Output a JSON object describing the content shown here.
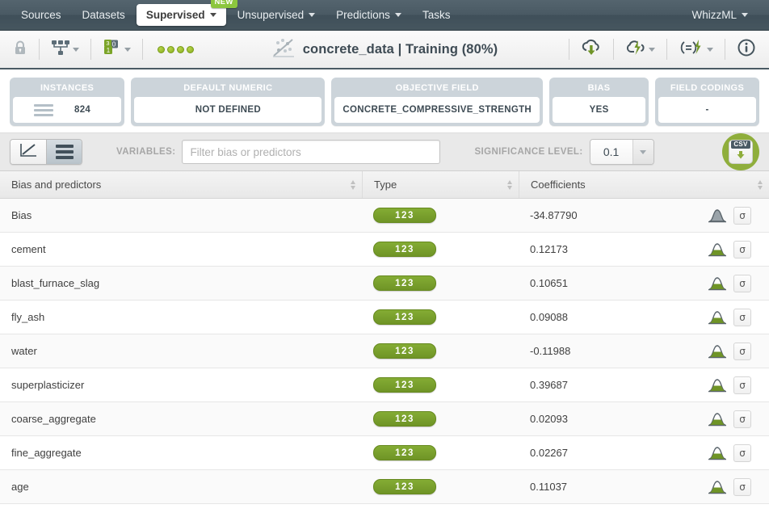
{
  "nav": {
    "items": [
      {
        "label": "Sources",
        "caret": false,
        "active": false,
        "badge": null
      },
      {
        "label": "Datasets",
        "caret": false,
        "active": false,
        "badge": null
      },
      {
        "label": "Supervised",
        "caret": true,
        "active": true,
        "badge": "NEW"
      },
      {
        "label": "Unsupervised",
        "caret": true,
        "active": false,
        "badge": null
      },
      {
        "label": "Predictions",
        "caret": true,
        "active": false,
        "badge": null
      },
      {
        "label": "Tasks",
        "caret": false,
        "active": false,
        "badge": null
      }
    ],
    "right": {
      "label": "WhizzML",
      "caret": true
    }
  },
  "toolbar": {
    "lock_icon": "lock-icon",
    "model_icon": "model-tree-icon",
    "fields_icon": "field-counts-icon",
    "fields_counts": {
      "top_left": "3",
      "top_right": "0",
      "bottom_left": "1"
    },
    "status_dots": 4,
    "title_icon": "regression-scatter-icon",
    "title": "concrete_data | Training (80%)",
    "right_icons": [
      {
        "name": "download-cloud-icon",
        "caret": false
      },
      {
        "name": "predict-cloud-icon",
        "caret": true
      },
      {
        "name": "batch-prediction-icon",
        "caret": true
      },
      {
        "name": "info-icon",
        "caret": false
      }
    ]
  },
  "cards": [
    {
      "title": "INSTANCES",
      "value": "824",
      "icon": "lines-icon"
    },
    {
      "title": "DEFAULT NUMERIC",
      "value": "NOT DEFINED",
      "icon": null
    },
    {
      "title": "OBJECTIVE FIELD",
      "value": "CONCRETE_COMPRESSIVE_STRENGTH",
      "icon": null
    },
    {
      "title": "BIAS",
      "value": "YES",
      "icon": null
    },
    {
      "title": "FIELD CODINGS",
      "value": "-",
      "icon": null
    }
  ],
  "controls": {
    "chart_view_icon": "line-chart-icon",
    "list_view_icon": "list-view-icon",
    "active_view": "list",
    "variables_label": "VARIABLES:",
    "filter_placeholder": "Filter bias or predictors",
    "filter_value": "",
    "significance_label": "SIGNIFICANCE LEVEL:",
    "significance_value": "0.1",
    "csv_label": "CSV",
    "csv_icon": "csv-download-icon"
  },
  "table": {
    "columns": [
      {
        "label": "Bias and predictors",
        "sortable": true
      },
      {
        "label": "Type",
        "sortable": true
      },
      {
        "label": "Coefficients",
        "sortable": true
      }
    ],
    "rows": [
      {
        "name": "Bias",
        "type": "123",
        "coefficient": "-34.87790",
        "bell_icon": "bell-curve-icon-filled",
        "sigma_label": "σ"
      },
      {
        "name": "cement",
        "type": "123",
        "coefficient": "0.12173",
        "bell_icon": "bell-curve-icon",
        "sigma_label": "σ"
      },
      {
        "name": "blast_furnace_slag",
        "type": "123",
        "coefficient": "0.10651",
        "bell_icon": "bell-curve-icon",
        "sigma_label": "σ"
      },
      {
        "name": "fly_ash",
        "type": "123",
        "coefficient": "0.09088",
        "bell_icon": "bell-curve-icon",
        "sigma_label": "σ"
      },
      {
        "name": "water",
        "type": "123",
        "coefficient": "-0.11988",
        "bell_icon": "bell-curve-icon",
        "sigma_label": "σ"
      },
      {
        "name": "superplasticizer",
        "type": "123",
        "coefficient": "0.39687",
        "bell_icon": "bell-curve-icon",
        "sigma_label": "σ"
      },
      {
        "name": "coarse_aggregate",
        "type": "123",
        "coefficient": "0.02093",
        "bell_icon": "bell-curve-icon",
        "sigma_label": "σ"
      },
      {
        "name": "fine_aggregate",
        "type": "123",
        "coefficient": "0.02267",
        "bell_icon": "bell-curve-icon",
        "sigma_label": "σ"
      },
      {
        "name": "age",
        "type": "123",
        "coefficient": "0.11037",
        "bell_icon": "bell-curve-icon",
        "sigma_label": "σ"
      }
    ]
  },
  "colors": {
    "nav_bg": "#4a5a64",
    "accent_green": "#8cc63e",
    "badge_green": "#7ba428",
    "card_header": "#ccd4da",
    "text_dark": "#3e4b54"
  }
}
